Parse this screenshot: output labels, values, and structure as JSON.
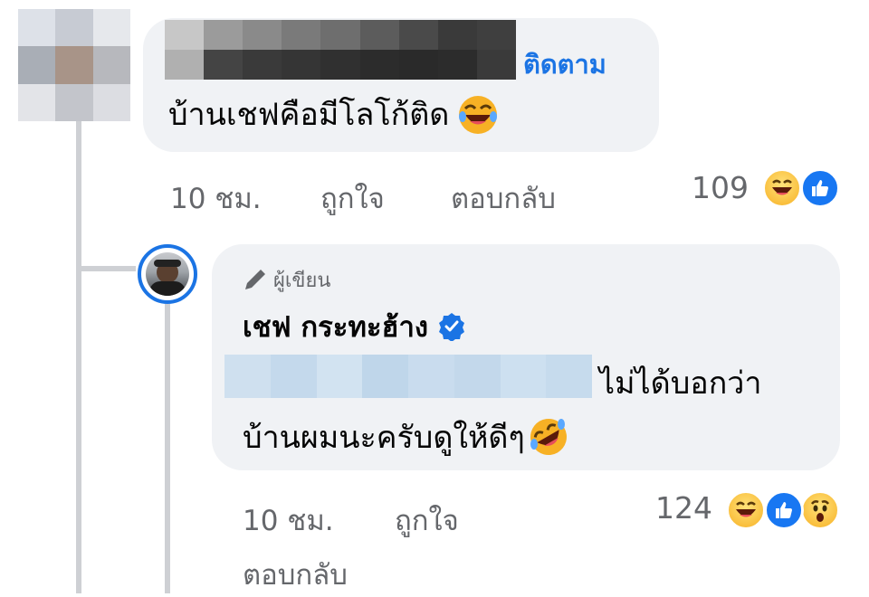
{
  "comment1": {
    "follow_label": "ติดตาม",
    "text": "บ้านเชฟคือมีโลโก้ติด",
    "emoji": "haha-emoji",
    "time": "10 ชม.",
    "like_label": "ถูกใจ",
    "reply_label": "ตอบกลับ",
    "reaction_count": "109",
    "reactions": [
      "haha",
      "like"
    ]
  },
  "reply": {
    "author_badge": "ผู้เขียน",
    "author_name": "เชฟ กระทะฮ้าง",
    "verified_icon": "verified-badge-icon",
    "text_line1": "ไม่ได้บอกว่า",
    "text_line2": "บ้านผมนะครับดูให้ดีๆ",
    "emoji": "rofl-emoji",
    "time": "10 ชม.",
    "like_label": "ถูกใจ",
    "reply_label": "ตอบกลับ",
    "reaction_count": "124",
    "reactions": [
      "haha",
      "like",
      "wow"
    ]
  },
  "colors": {
    "accent": "#1b74e4",
    "bubble": "#f0f2f5",
    "meta_text": "#65676b",
    "thread_line": "#ced0d4"
  }
}
